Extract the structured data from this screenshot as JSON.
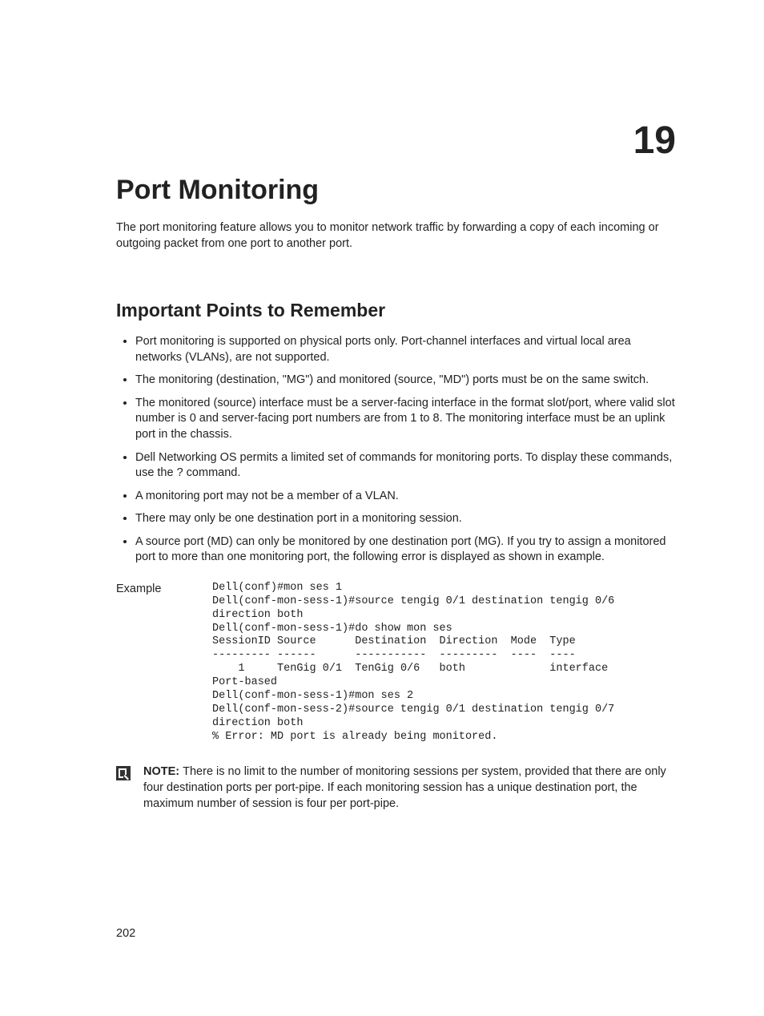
{
  "chapter_number": "19",
  "title": "Port Monitoring",
  "intro": "The port monitoring feature allows you to monitor network traffic by forwarding a copy of each incoming or outgoing packet from one port to another port.",
  "section_heading": "Important Points to Remember",
  "bullets": [
    "Port monitoring is supported on physical ports only. Port-channel interfaces and virtual local area networks (VLANs), are not supported.",
    "The monitoring (destination, \"MG\") and monitored (source, \"MD\") ports must be on the same switch.",
    "The monitored (source) interface must be a server-facing interface in the format slot/port, where valid slot number is 0 and server-facing port numbers are from 1 to 8. The monitoring interface must be an uplink port in the chassis.",
    "Dell Networking OS permits a limited set of commands for monitoring ports. To display these commands, use the ? command.",
    "A monitoring port may not be a member of a VLAN.",
    "There may only be one destination port in a monitoring session.",
    "A source port (MD) can only be monitored by one destination port (MG). If you try to assign a monitored port to more than one monitoring port, the following error is displayed as shown in example."
  ],
  "example_label": "Example",
  "terminal": "Dell(conf)#mon ses 1\nDell(conf-mon-sess-1)#source tengig 0/1 destination tengig 0/6 \ndirection both\nDell(conf-mon-sess-1)#do show mon ses\nSessionID Source      Destination  Direction  Mode  Type\n--------- ------      -----------  ---------  ----  ----\n    1     TenGig 0/1  TenGig 0/6   both             interface \nPort-based\nDell(conf-mon-sess-1)#mon ses 2\nDell(conf-mon-sess-2)#source tengig 0/1 destination tengig 0/7 \ndirection both\n% Error: MD port is already being monitored.",
  "note_label": "NOTE: ",
  "note_text": "There is no limit to the number of monitoring sessions per system, provided that there are only four destination ports per port-pipe. If each monitoring session has a unique destination port, the maximum number of session is four per port-pipe.",
  "page_number": "202"
}
